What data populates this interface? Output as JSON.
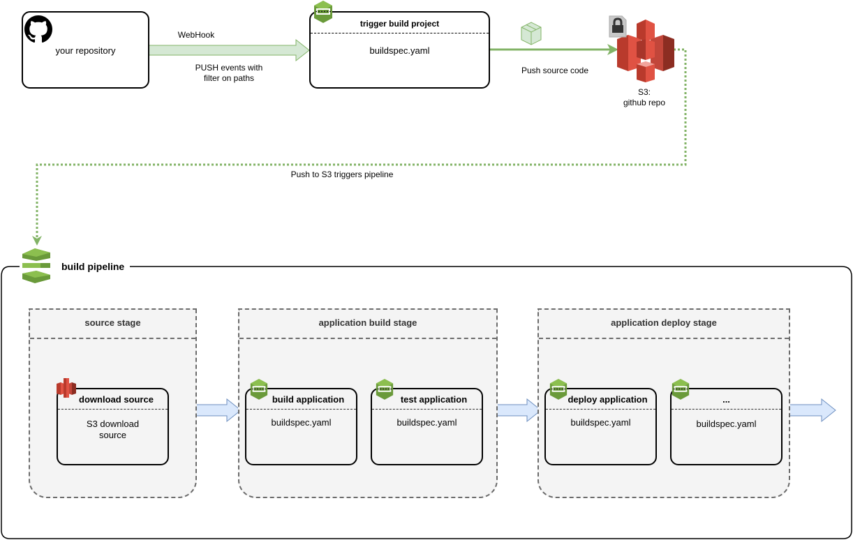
{
  "repository": {
    "label": "your repository",
    "icon": "github-icon"
  },
  "webhook_arrow": {
    "top_label": "WebHook",
    "bottom_label": "PUSH events with\nfilter on paths"
  },
  "trigger_project": {
    "title": "trigger build project",
    "body": "buildspec.yaml",
    "icon": "codebuild-icon"
  },
  "push_arrow": {
    "label": "Push source code",
    "icon": "package-icon"
  },
  "s3_bucket": {
    "label": "S3:\ngithub repo",
    "icon": "s3-bucket-icon",
    "badge_icon": "lock-icon"
  },
  "trigger_link": {
    "label": "Push to S3 triggers pipeline"
  },
  "pipeline": {
    "title": "build pipeline",
    "icon": "codepipeline-icon",
    "stages": [
      {
        "title": "source stage",
        "jobs": [
          {
            "title": "download source",
            "body": "S3 download\nsource",
            "icon": "s3-icon"
          }
        ]
      },
      {
        "title": "application build stage",
        "jobs": [
          {
            "title": "build application",
            "body": "buildspec.yaml",
            "icon": "codebuild-icon"
          },
          {
            "title": "test application",
            "body": "buildspec.yaml",
            "icon": "codebuild-icon"
          }
        ]
      },
      {
        "title": "application deploy stage",
        "jobs": [
          {
            "title": "deploy application",
            "body": "buildspec.yaml",
            "icon": "codebuild-icon"
          },
          {
            "title": "...",
            "body": "buildspec.yaml",
            "icon": "codebuild-icon"
          }
        ]
      }
    ]
  },
  "colors": {
    "green_arrow": "#82b366",
    "green_fill": "#d5e8d4",
    "blue_arrow_fill": "#dae8fc",
    "blue_arrow_stroke": "#6c8ebf",
    "aws_green": "#6a9a3a",
    "aws_red": "#e05243",
    "stage_fill": "#f4f4f4",
    "stage_border": "#6b6b6b"
  }
}
